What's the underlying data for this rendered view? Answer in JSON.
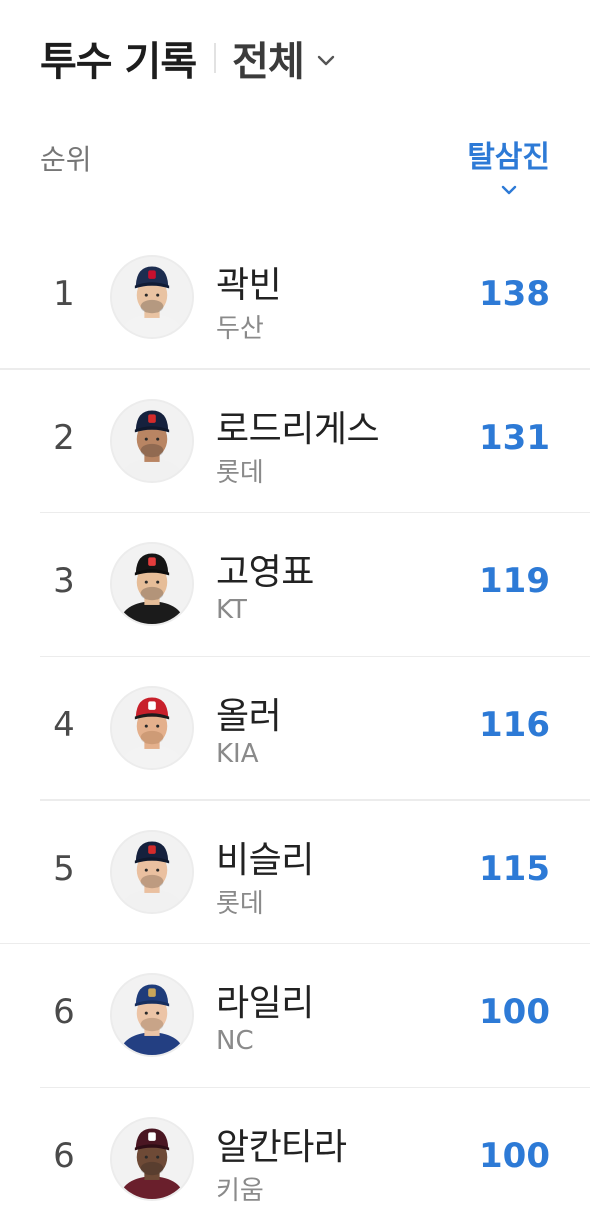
{
  "header": {
    "title": "투수 기록",
    "filter_label": "전체"
  },
  "columns": {
    "rank": "순위",
    "sort": "탈삼진"
  },
  "colors": {
    "accent": "#2d7ad6"
  },
  "players": [
    {
      "rank": "1",
      "name": "곽빈",
      "team": "두산",
      "value": "138",
      "cap": "#1d2d50",
      "bill": "#101c36",
      "logo": "#c8102e",
      "jersey": "#f3f3f3",
      "hair": "#1a1a1a",
      "skin": "#e9c3a2"
    },
    {
      "rank": "2",
      "name": "로드리게스",
      "team": "롯데",
      "value": "131",
      "cap": "#15213d",
      "bill": "#0f182c",
      "logo": "#d42b2b",
      "jersey": "#f1f1f1",
      "hair": "#1a1a1a",
      "skin": "#b98563"
    },
    {
      "rank": "3",
      "name": "고영표",
      "team": "KT",
      "value": "119",
      "cap": "#151515",
      "bill": "#0c0c0c",
      "logo": "#e43c3c",
      "jersey": "#1b1b1b",
      "hair": "#1a1a1a",
      "skin": "#e6bd98"
    },
    {
      "rank": "4",
      "name": "올러",
      "team": "KIA",
      "value": "116",
      "cap": "#c8202b",
      "bill": "#1c1c1c",
      "logo": "#ffffff",
      "jersey": "#f3f3f3",
      "hair": "#8a5a34",
      "skin": "#e4b08c"
    },
    {
      "rank": "5",
      "name": "비슬리",
      "team": "롯데",
      "value": "115",
      "cap": "#15213d",
      "bill": "#0f182c",
      "logo": "#d42b2b",
      "jersey": "#f1f1f1",
      "hair": "#3a2a1e",
      "skin": "#eac0a0"
    },
    {
      "rank": "6",
      "name": "라일리",
      "team": "NC",
      "value": "100",
      "cap": "#1f3c7a",
      "bill": "#172e5e",
      "logo": "#c9a55a",
      "jersey": "#233f82",
      "hair": "#5b4330",
      "skin": "#ecc4a6"
    },
    {
      "rank": "6",
      "name": "알칸타라",
      "team": "키움",
      "value": "100",
      "cap": "#4a1622",
      "bill": "#2e0d15",
      "logo": "#ffffff",
      "jersey": "#6a1f2c",
      "hair": "#1a1a1a",
      "skin": "#6e4a36"
    }
  ]
}
